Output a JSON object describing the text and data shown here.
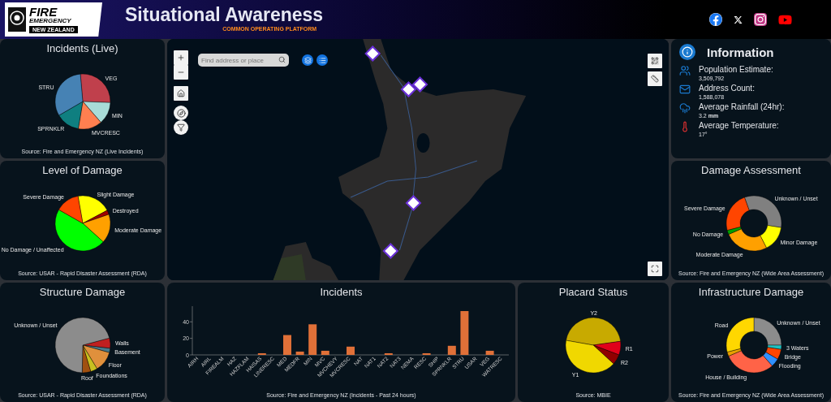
{
  "header": {
    "logo": {
      "line_1": "FIRE",
      "line_2": "EMERGENCY",
      "line_3": "NEW ZEALAND"
    },
    "title": "Situational Awareness",
    "subtitle": "COMMON OPERATING PLATFORM"
  },
  "incidents_live": {
    "title": "Incidents (Live)",
    "source": "Source: Fire and Emergency NZ (Live Incidents)",
    "slices": [
      {
        "label": "VEG",
        "color": "#c0404c"
      },
      {
        "label": "MIN",
        "color": "#a8dcd8"
      },
      {
        "label": "MVCRESC",
        "color": "#ff7f50"
      },
      {
        "label": "SPRNKLR",
        "color": "#0f7f80"
      },
      {
        "label": "STRU",
        "color": "#4682b4"
      }
    ]
  },
  "level_of_damage": {
    "title": "Level of Damage",
    "source": "Source: USAR - Rapid Disaster Assessment (RDA)",
    "slices": [
      {
        "label": "Slight Damage",
        "color": "#ffff00"
      },
      {
        "label": "Destroyed",
        "color": "#a00000"
      },
      {
        "label": "Moderate Damage",
        "color": "#ffa000"
      },
      {
        "label": "Severe Damage",
        "color": "#ff4500"
      },
      {
        "label": "No Damage / Unaffected",
        "color": "#00ff00"
      }
    ]
  },
  "map": {
    "search": {
      "placeholder": "Find address or place"
    }
  },
  "information": {
    "title": "Information",
    "items": [
      {
        "label": "Population Estimate:",
        "value": "3,509,792"
      },
      {
        "label": "Address Count:",
        "value": "1,588,078"
      },
      {
        "label": "Average Rainfall (24hr):",
        "value": "3.2 **mm**"
      },
      {
        "label": "Average Temperature:",
        "value": "17°"
      }
    ]
  },
  "damage_assessment": {
    "title": "Damage Assessment",
    "source": "Source: Fire and Emergency NZ (Wide Area Assessment)",
    "slices": [
      {
        "label": "Unknown / Unset",
        "color": "#808080"
      },
      {
        "label": "Severe Damage",
        "color": "#ff4500"
      },
      {
        "label": "Minor Damage",
        "color": "#ffff00"
      },
      {
        "label": "No Damage",
        "color": "#00a000"
      },
      {
        "label": "Moderate Damage",
        "color": "#ffa000"
      }
    ]
  },
  "structure_damage": {
    "title": "Structure Damage",
    "source": "Source: USAR - Rapid Disaster Assessment (RDA)",
    "slices": [
      {
        "label": "Walls",
        "color": "#c02020"
      },
      {
        "label": "Basement",
        "color": "#4a7a8a"
      },
      {
        "label": "Floor",
        "color": "#e0903c"
      },
      {
        "label": "Foundations",
        "color": "#c8c020"
      },
      {
        "label": "Roof",
        "color": "#a05010"
      },
      {
        "label": "Unknown / Unset",
        "color": "#8c8c8c"
      }
    ]
  },
  "incidents": {
    "title": "Incidents",
    "source": "Source: Fire and Emergency NZ (Incidents - Past 24 hours)",
    "chart_data": {
      "type": "bar",
      "categories": [
        "AIRH",
        "AIRL",
        "FIREALM",
        "HAZ",
        "HAZFLAM",
        "HAISAS",
        "LINERESC",
        "MED",
        "MEDFR",
        "MIN",
        "MVC",
        "MVCHEVY",
        "MVCRESC",
        "NAT",
        "NAT1",
        "NAT2",
        "NAT3",
        "NEMA",
        "RESC",
        "SHIP",
        "SPRNKLR",
        "STRU",
        "USAR",
        "VEG",
        "WATRESC"
      ],
      "values": [
        0,
        0,
        0,
        0,
        0,
        2,
        0,
        24,
        4,
        37,
        5,
        0,
        10,
        0,
        0,
        2,
        0,
        0,
        2,
        0,
        11,
        53,
        0,
        5,
        0
      ],
      "ylim": [
        0,
        55
      ],
      "yticks": [
        0,
        20,
        40
      ]
    }
  },
  "placard_status": {
    "title": "Placard Status",
    "source": "Source: MBIE",
    "slices": [
      {
        "label": "Y2",
        "color": "#c8aa00"
      },
      {
        "label": "R1",
        "color": "#e0001a"
      },
      {
        "label": "R2",
        "color": "#900000"
      },
      {
        "label": "Y1",
        "color": "#f0d800"
      }
    ]
  },
  "infrastructure_damage": {
    "title": "Infrastructure Damage",
    "source": "Source: Fire and Emergency NZ (Wide Area Assessment)",
    "slices": [
      {
        "label": "Unknown / Unset",
        "color": "#8c8c8c"
      },
      {
        "label": "3 Waters",
        "color": "#20c0c0"
      },
      {
        "label": "Bridge",
        "color": "#ff4500"
      },
      {
        "label": "Flooding",
        "color": "#3090ff"
      },
      {
        "label": "Power",
        "color": "#e8a000"
      },
      {
        "label": "House / Building",
        "color": "#ff6347"
      },
      {
        "label": "Road",
        "color": "#ffd700"
      }
    ]
  }
}
